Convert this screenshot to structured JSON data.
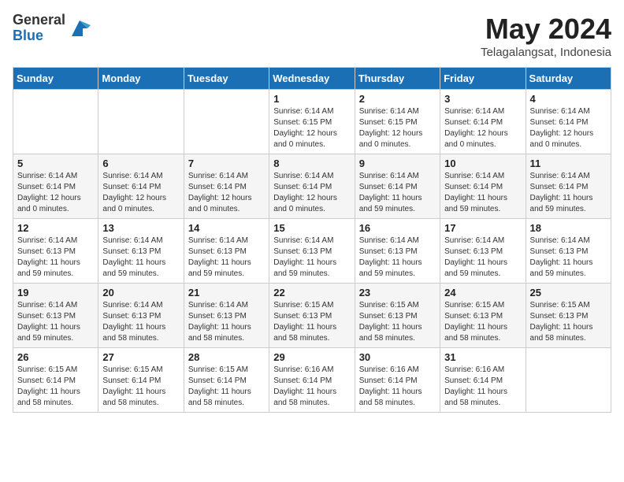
{
  "header": {
    "logo_general": "General",
    "logo_blue": "Blue",
    "month_year": "May 2024",
    "location": "Telagalangsat, Indonesia"
  },
  "days_of_week": [
    "Sunday",
    "Monday",
    "Tuesday",
    "Wednesday",
    "Thursday",
    "Friday",
    "Saturday"
  ],
  "weeks": [
    [
      {
        "day": "",
        "info": ""
      },
      {
        "day": "",
        "info": ""
      },
      {
        "day": "",
        "info": ""
      },
      {
        "day": "1",
        "info": "Sunrise: 6:14 AM\nSunset: 6:15 PM\nDaylight: 12 hours\nand 0 minutes."
      },
      {
        "day": "2",
        "info": "Sunrise: 6:14 AM\nSunset: 6:15 PM\nDaylight: 12 hours\nand 0 minutes."
      },
      {
        "day": "3",
        "info": "Sunrise: 6:14 AM\nSunset: 6:14 PM\nDaylight: 12 hours\nand 0 minutes."
      },
      {
        "day": "4",
        "info": "Sunrise: 6:14 AM\nSunset: 6:14 PM\nDaylight: 12 hours\nand 0 minutes."
      }
    ],
    [
      {
        "day": "5",
        "info": "Sunrise: 6:14 AM\nSunset: 6:14 PM\nDaylight: 12 hours\nand 0 minutes."
      },
      {
        "day": "6",
        "info": "Sunrise: 6:14 AM\nSunset: 6:14 PM\nDaylight: 12 hours\nand 0 minutes."
      },
      {
        "day": "7",
        "info": "Sunrise: 6:14 AM\nSunset: 6:14 PM\nDaylight: 12 hours\nand 0 minutes."
      },
      {
        "day": "8",
        "info": "Sunrise: 6:14 AM\nSunset: 6:14 PM\nDaylight: 12 hours\nand 0 minutes."
      },
      {
        "day": "9",
        "info": "Sunrise: 6:14 AM\nSunset: 6:14 PM\nDaylight: 11 hours\nand 59 minutes."
      },
      {
        "day": "10",
        "info": "Sunrise: 6:14 AM\nSunset: 6:14 PM\nDaylight: 11 hours\nand 59 minutes."
      },
      {
        "day": "11",
        "info": "Sunrise: 6:14 AM\nSunset: 6:14 PM\nDaylight: 11 hours\nand 59 minutes."
      }
    ],
    [
      {
        "day": "12",
        "info": "Sunrise: 6:14 AM\nSunset: 6:13 PM\nDaylight: 11 hours\nand 59 minutes."
      },
      {
        "day": "13",
        "info": "Sunrise: 6:14 AM\nSunset: 6:13 PM\nDaylight: 11 hours\nand 59 minutes."
      },
      {
        "day": "14",
        "info": "Sunrise: 6:14 AM\nSunset: 6:13 PM\nDaylight: 11 hours\nand 59 minutes."
      },
      {
        "day": "15",
        "info": "Sunrise: 6:14 AM\nSunset: 6:13 PM\nDaylight: 11 hours\nand 59 minutes."
      },
      {
        "day": "16",
        "info": "Sunrise: 6:14 AM\nSunset: 6:13 PM\nDaylight: 11 hours\nand 59 minutes."
      },
      {
        "day": "17",
        "info": "Sunrise: 6:14 AM\nSunset: 6:13 PM\nDaylight: 11 hours\nand 59 minutes."
      },
      {
        "day": "18",
        "info": "Sunrise: 6:14 AM\nSunset: 6:13 PM\nDaylight: 11 hours\nand 59 minutes."
      }
    ],
    [
      {
        "day": "19",
        "info": "Sunrise: 6:14 AM\nSunset: 6:13 PM\nDaylight: 11 hours\nand 59 minutes."
      },
      {
        "day": "20",
        "info": "Sunrise: 6:14 AM\nSunset: 6:13 PM\nDaylight: 11 hours\nand 58 minutes."
      },
      {
        "day": "21",
        "info": "Sunrise: 6:14 AM\nSunset: 6:13 PM\nDaylight: 11 hours\nand 58 minutes."
      },
      {
        "day": "22",
        "info": "Sunrise: 6:15 AM\nSunset: 6:13 PM\nDaylight: 11 hours\nand 58 minutes."
      },
      {
        "day": "23",
        "info": "Sunrise: 6:15 AM\nSunset: 6:13 PM\nDaylight: 11 hours\nand 58 minutes."
      },
      {
        "day": "24",
        "info": "Sunrise: 6:15 AM\nSunset: 6:13 PM\nDaylight: 11 hours\nand 58 minutes."
      },
      {
        "day": "25",
        "info": "Sunrise: 6:15 AM\nSunset: 6:13 PM\nDaylight: 11 hours\nand 58 minutes."
      }
    ],
    [
      {
        "day": "26",
        "info": "Sunrise: 6:15 AM\nSunset: 6:14 PM\nDaylight: 11 hours\nand 58 minutes."
      },
      {
        "day": "27",
        "info": "Sunrise: 6:15 AM\nSunset: 6:14 PM\nDaylight: 11 hours\nand 58 minutes."
      },
      {
        "day": "28",
        "info": "Sunrise: 6:15 AM\nSunset: 6:14 PM\nDaylight: 11 hours\nand 58 minutes."
      },
      {
        "day": "29",
        "info": "Sunrise: 6:16 AM\nSunset: 6:14 PM\nDaylight: 11 hours\nand 58 minutes."
      },
      {
        "day": "30",
        "info": "Sunrise: 6:16 AM\nSunset: 6:14 PM\nDaylight: 11 hours\nand 58 minutes."
      },
      {
        "day": "31",
        "info": "Sunrise: 6:16 AM\nSunset: 6:14 PM\nDaylight: 11 hours\nand 58 minutes."
      },
      {
        "day": "",
        "info": ""
      }
    ]
  ]
}
